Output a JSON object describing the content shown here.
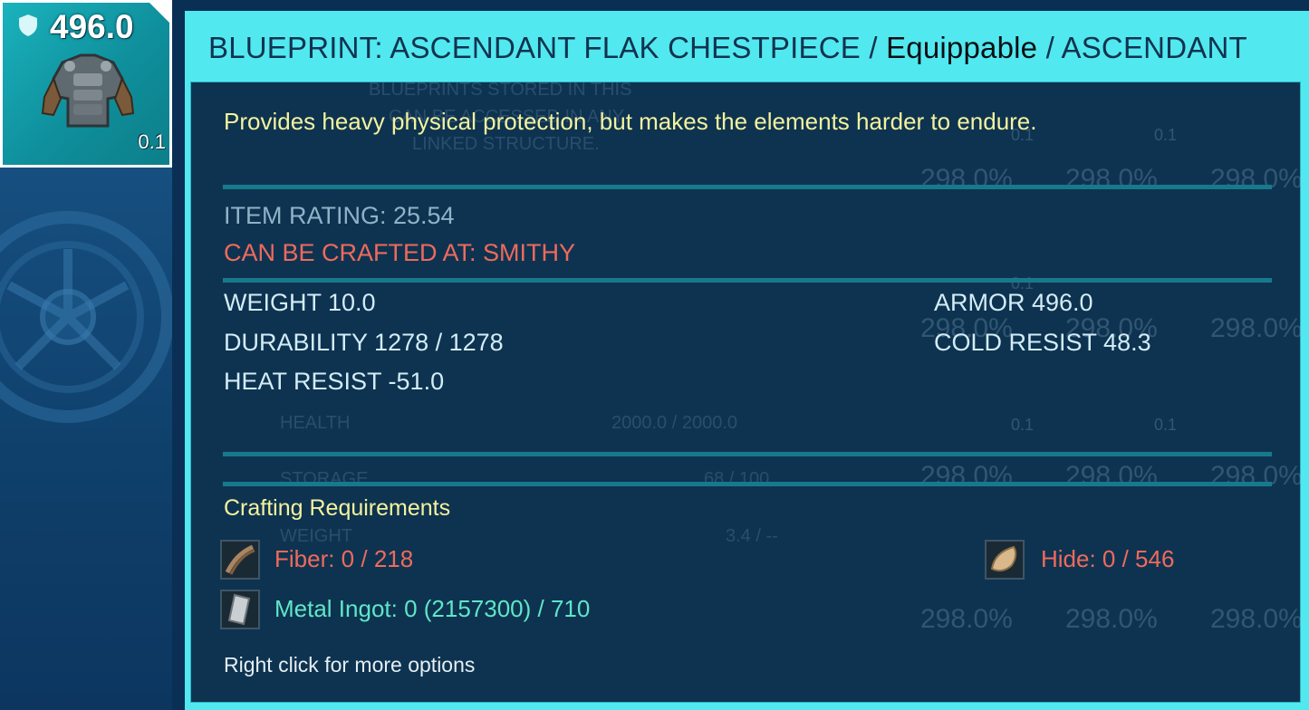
{
  "item_slot": {
    "armor_value": "496.0",
    "weight": "0.1",
    "icon": "flak-chestpiece-icon"
  },
  "tooltip": {
    "title_prefix": "BLUEPRINT: ASCENDANT FLAK CHESTPIECE",
    "title_sep1": " / ",
    "title_type": "Equippable",
    "title_sep2": " / ",
    "title_quality": "ASCENDANT",
    "description": "Provides heavy physical protection, but makes the elements harder to endure.",
    "item_rating": "ITEM RATING: 25.54",
    "crafted_at": "CAN BE CRAFTED AT: SMITHY",
    "stats_left": [
      "WEIGHT 10.0",
      "DURABILITY 1278 / 1278",
      "HEAT RESIST -51.0"
    ],
    "stats_right": [
      "ARMOR 496.0",
      "COLD RESIST 48.3"
    ],
    "requirements_title": "Crafting Requirements",
    "requirements": [
      {
        "label": "Fiber: 0 / 218",
        "status": "missing",
        "icon": "fiber-icon"
      },
      {
        "label": "Hide: 0 / 546",
        "status": "missing",
        "icon": "hide-icon"
      },
      {
        "label": "Metal Ingot: 0 (2157300) / 710",
        "status": "available",
        "icon": "metal-ingot-icon"
      }
    ],
    "hint": "Right click for more options"
  },
  "background": {
    "ghost_text": [
      "BLUEPRINTS STORED IN THIS",
      "CAN BE ACCESSED IN ANY",
      "LINKED STRUCTURE.",
      "HEALTH",
      "2000.0 / 2000.0",
      "STORAGE",
      "68 / 100",
      "WEIGHT",
      "3.4 / --"
    ],
    "percent_label": "298.0%",
    "weight_label": "0.1"
  },
  "colors": {
    "tooltip_header": "#52e8f0",
    "description": "#f3f29e",
    "error_red": "#ef6a5c",
    "ok_green": "#5fe6c8",
    "stat_text": "#d3ecf6"
  }
}
